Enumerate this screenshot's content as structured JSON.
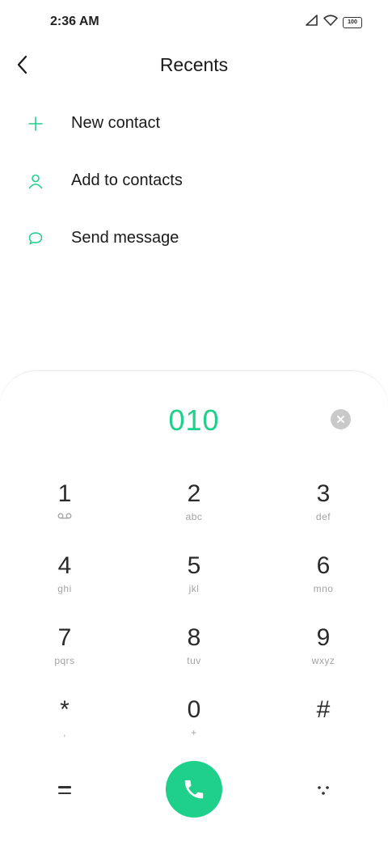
{
  "status_bar": {
    "time": "2:36 AM",
    "battery_level": "100"
  },
  "header": {
    "title": "Recents"
  },
  "actions": [
    {
      "label": "New contact",
      "icon": "plus-icon"
    },
    {
      "label": "Add to contacts",
      "icon": "person-icon"
    },
    {
      "label": "Send message",
      "icon": "chat-bubble-icon"
    }
  ],
  "dialpad": {
    "number": "010",
    "keys": [
      {
        "digit": "1",
        "letters": "voicemail-icon"
      },
      {
        "digit": "2",
        "letters": "abc"
      },
      {
        "digit": "3",
        "letters": "def"
      },
      {
        "digit": "4",
        "letters": "ghi"
      },
      {
        "digit": "5",
        "letters": "jkl"
      },
      {
        "digit": "6",
        "letters": "mno"
      },
      {
        "digit": "7",
        "letters": "pqrs"
      },
      {
        "digit": "8",
        "letters": "tuv"
      },
      {
        "digit": "9",
        "letters": "wxyz"
      },
      {
        "digit": "*",
        "letters": ","
      },
      {
        "digit": "0",
        "letters": "+"
      },
      {
        "digit": "#",
        "letters": ""
      }
    ]
  },
  "colors": {
    "accent": "#1ed089"
  }
}
